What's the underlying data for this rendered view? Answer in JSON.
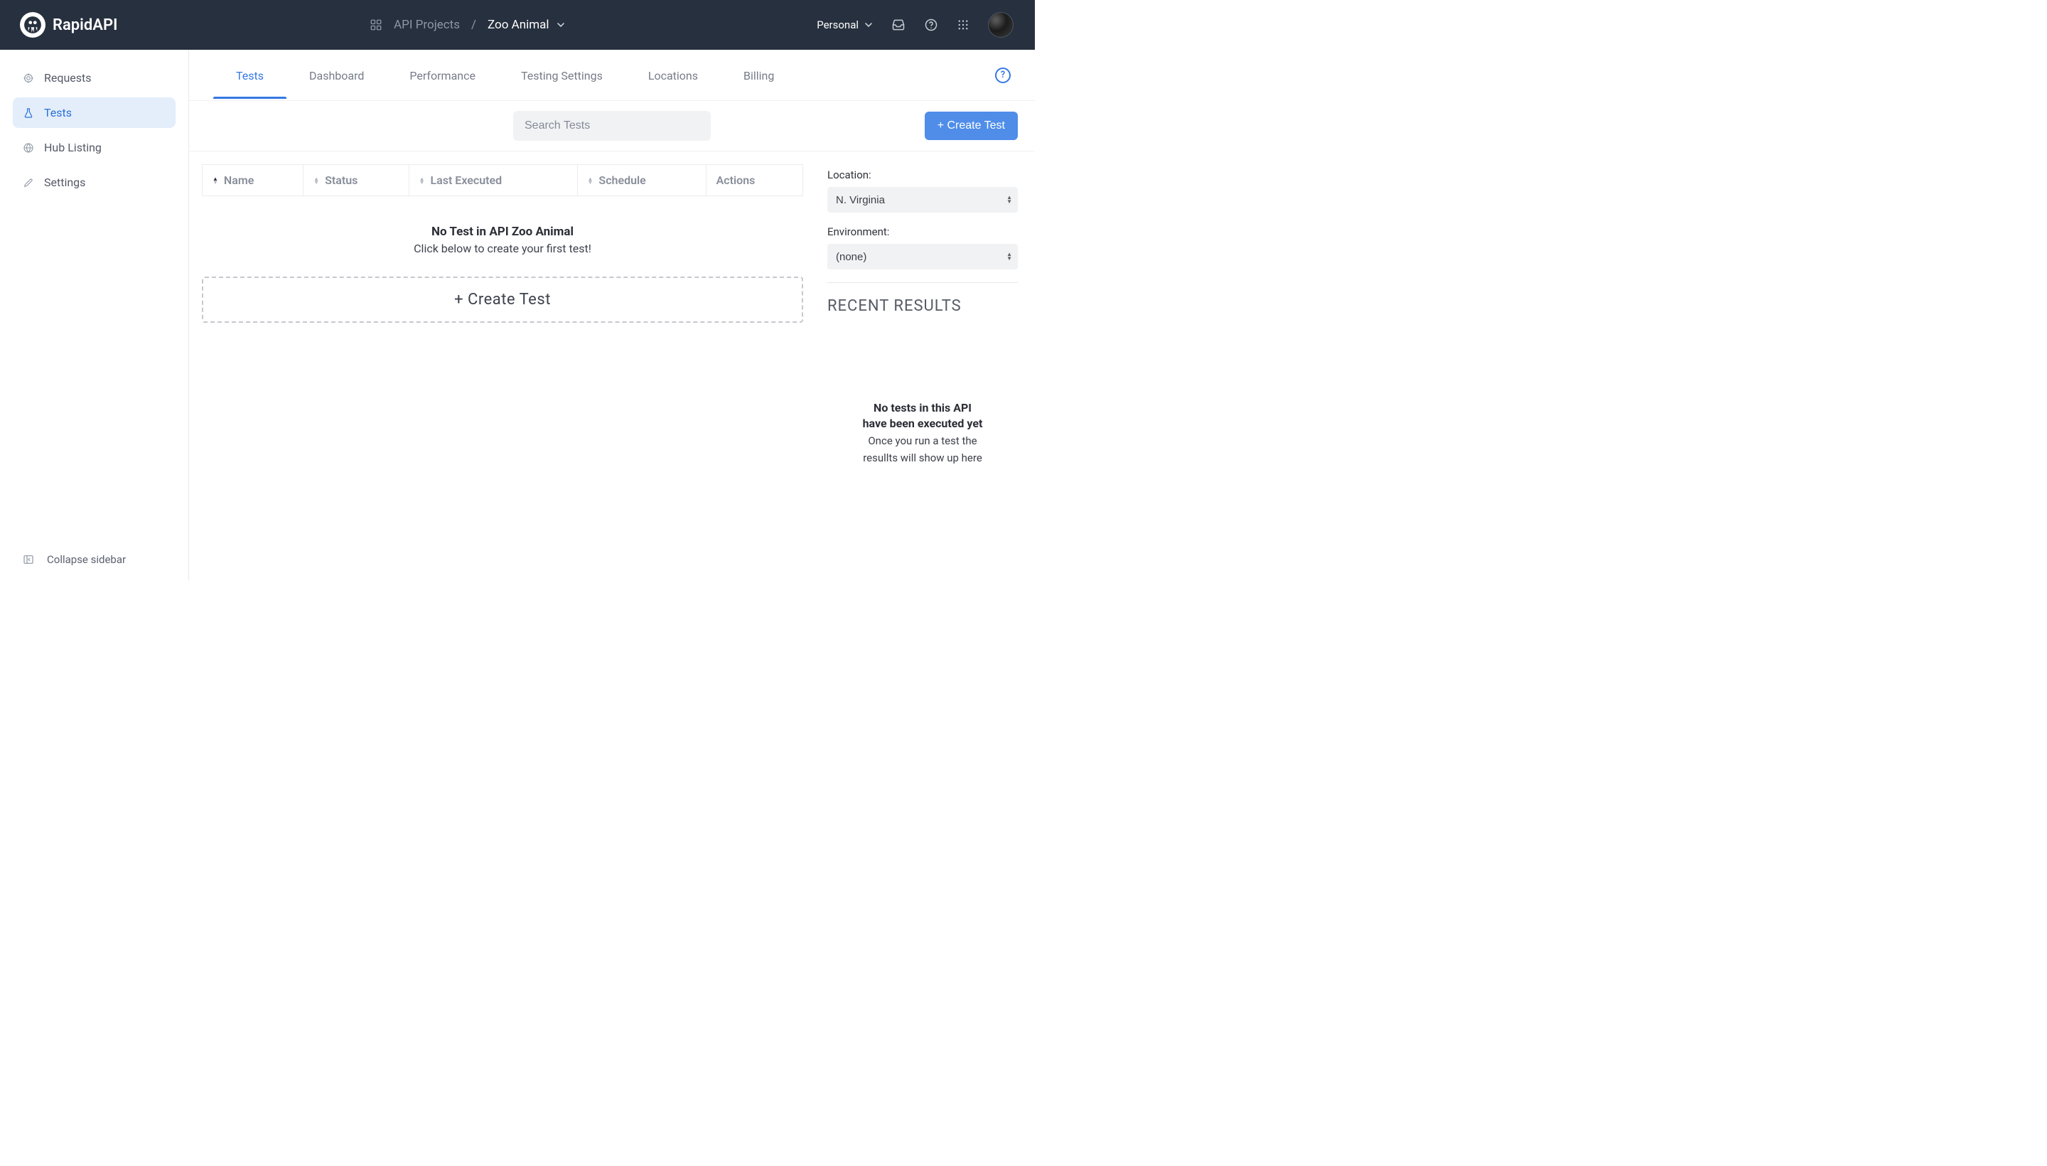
{
  "header": {
    "brand": "RapidAPI",
    "breadcrumb": {
      "root": "API Projects",
      "project": "Zoo Animal"
    },
    "right": {
      "workspace": "Personal"
    }
  },
  "sidebar": {
    "items": [
      {
        "label": "Requests",
        "active": false
      },
      {
        "label": "Tests",
        "active": true
      },
      {
        "label": "Hub Listing",
        "active": false
      },
      {
        "label": "Settings",
        "active": false
      }
    ],
    "collapse": "Collapse sidebar"
  },
  "tabs": [
    {
      "label": "Tests",
      "active": true
    },
    {
      "label": "Dashboard",
      "active": false
    },
    {
      "label": "Performance",
      "active": false
    },
    {
      "label": "Testing Settings",
      "active": false
    },
    {
      "label": "Locations",
      "active": false
    },
    {
      "label": "Billing",
      "active": false
    }
  ],
  "toolbar": {
    "searchPlaceholder": "Search Tests",
    "createButton": "+ Create Test"
  },
  "table": {
    "columns": [
      "Name",
      "Status",
      "Last Executed",
      "Schedule",
      "Actions"
    ]
  },
  "emptyState": {
    "title": "No Test in API Zoo Animal",
    "subtitle": "Click below to create your first test!",
    "createLabel": "+  Create Test"
  },
  "rightPanel": {
    "locationLabel": "Location:",
    "locationValue": "N. Virginia",
    "environmentLabel": "Environment:",
    "environmentValue": "(none)",
    "recentResultsTitle": "RECENT RESULTS",
    "resultsEmpty": {
      "bold1": "No tests in this API",
      "bold2": "have been executed yet",
      "sub1": "Once you run a test the",
      "sub2": "resullts will show up here"
    }
  }
}
